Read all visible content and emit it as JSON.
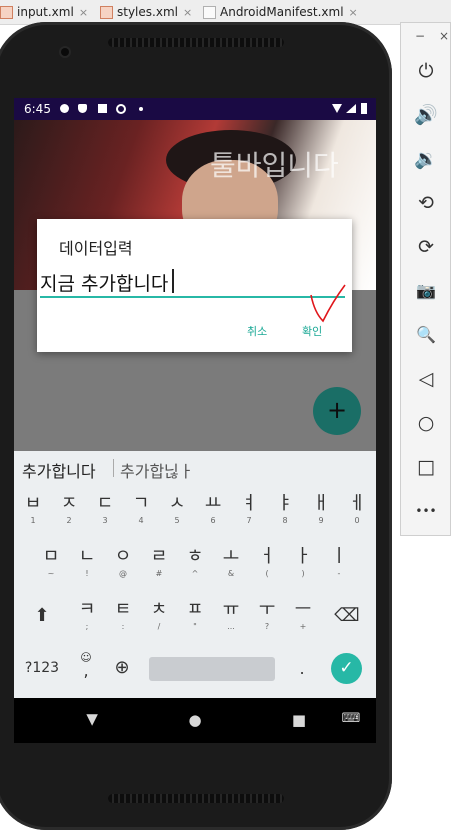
{
  "ide_tabs": [
    {
      "label": "input.xml",
      "icon": "xml-file-icon"
    },
    {
      "label": "styles.xml",
      "icon": "xml-file-icon"
    },
    {
      "label": "AndroidManifest.xml",
      "icon": "manifest-file-icon"
    }
  ],
  "tab_close_glyph": "×",
  "status_bar": {
    "time": "6:45",
    "background": "#1a0a44"
  },
  "app": {
    "toolbar_title": "툴바입니다",
    "fab_glyph": "+",
    "fab_color": "#1a6e66"
  },
  "dialog": {
    "title": "데이터입력",
    "input_value": "지금 추가합니다",
    "cancel_label": "취소",
    "ok_label": "확인",
    "accent": "#27b8a6"
  },
  "keyboard": {
    "suggestions": [
      "추가합니다",
      "추가합닎ㅏ"
    ],
    "row1": [
      {
        "main": "ㅂ",
        "sub": "1"
      },
      {
        "main": "ㅈ",
        "sub": "2"
      },
      {
        "main": "ㄷ",
        "sub": "3"
      },
      {
        "main": "ㄱ",
        "sub": "4"
      },
      {
        "main": "ㅅ",
        "sub": "5"
      },
      {
        "main": "ㅛ",
        "sub": "6"
      },
      {
        "main": "ㅕ",
        "sub": "7"
      },
      {
        "main": "ㅑ",
        "sub": "8"
      },
      {
        "main": "ㅐ",
        "sub": "9"
      },
      {
        "main": "ㅔ",
        "sub": "0"
      }
    ],
    "row2": [
      {
        "main": "ㅁ",
        "sub": "~"
      },
      {
        "main": "ㄴ",
        "sub": "!"
      },
      {
        "main": "ㅇ",
        "sub": "@"
      },
      {
        "main": "ㄹ",
        "sub": "#"
      },
      {
        "main": "ㅎ",
        "sub": "^"
      },
      {
        "main": "ㅗ",
        "sub": "&"
      },
      {
        "main": "ㅓ",
        "sub": "("
      },
      {
        "main": "ㅏ",
        "sub": ")"
      },
      {
        "main": "ㅣ",
        "sub": "-"
      }
    ],
    "row3": [
      {
        "main": "ㅋ",
        "sub": ";"
      },
      {
        "main": "ㅌ",
        "sub": ":"
      },
      {
        "main": "ㅊ",
        "sub": "/"
      },
      {
        "main": "ㅍ",
        "sub": "\""
      },
      {
        "main": "ㅠ",
        "sub": "..."
      },
      {
        "main": "ㅜ",
        "sub": "?"
      },
      {
        "main": "ㅡ",
        "sub": "+"
      }
    ],
    "shift_glyph": "⬆",
    "backspace_glyph": "⌫",
    "symbols_label": "?123",
    "emoji_glyph": "☺",
    "comma_label": ",",
    "globe_glyph": "⊕",
    "period_label": ".",
    "enter_glyph": "✓"
  },
  "nav": {
    "back_glyph": "◀",
    "home_glyph": "●",
    "recents_glyph": "■",
    "keyboard_glyph": "⌨"
  },
  "emulator_panel": {
    "minimize_glyph": "−",
    "close_glyph": "×",
    "tools": [
      {
        "name": "power-icon",
        "glyph": "⏻"
      },
      {
        "name": "volume-up-icon",
        "glyph": "🔊"
      },
      {
        "name": "volume-down-icon",
        "glyph": "🔉"
      },
      {
        "name": "rotate-left-icon",
        "glyph": "⟲"
      },
      {
        "name": "rotate-right-icon",
        "glyph": "⟳"
      },
      {
        "name": "camera-icon",
        "glyph": "📷"
      },
      {
        "name": "zoom-icon",
        "glyph": "🔍"
      },
      {
        "name": "back-icon",
        "glyph": "◁"
      },
      {
        "name": "home-icon",
        "glyph": "○"
      },
      {
        "name": "overview-icon",
        "glyph": "□"
      },
      {
        "name": "more-icon",
        "glyph": "•••"
      }
    ]
  }
}
